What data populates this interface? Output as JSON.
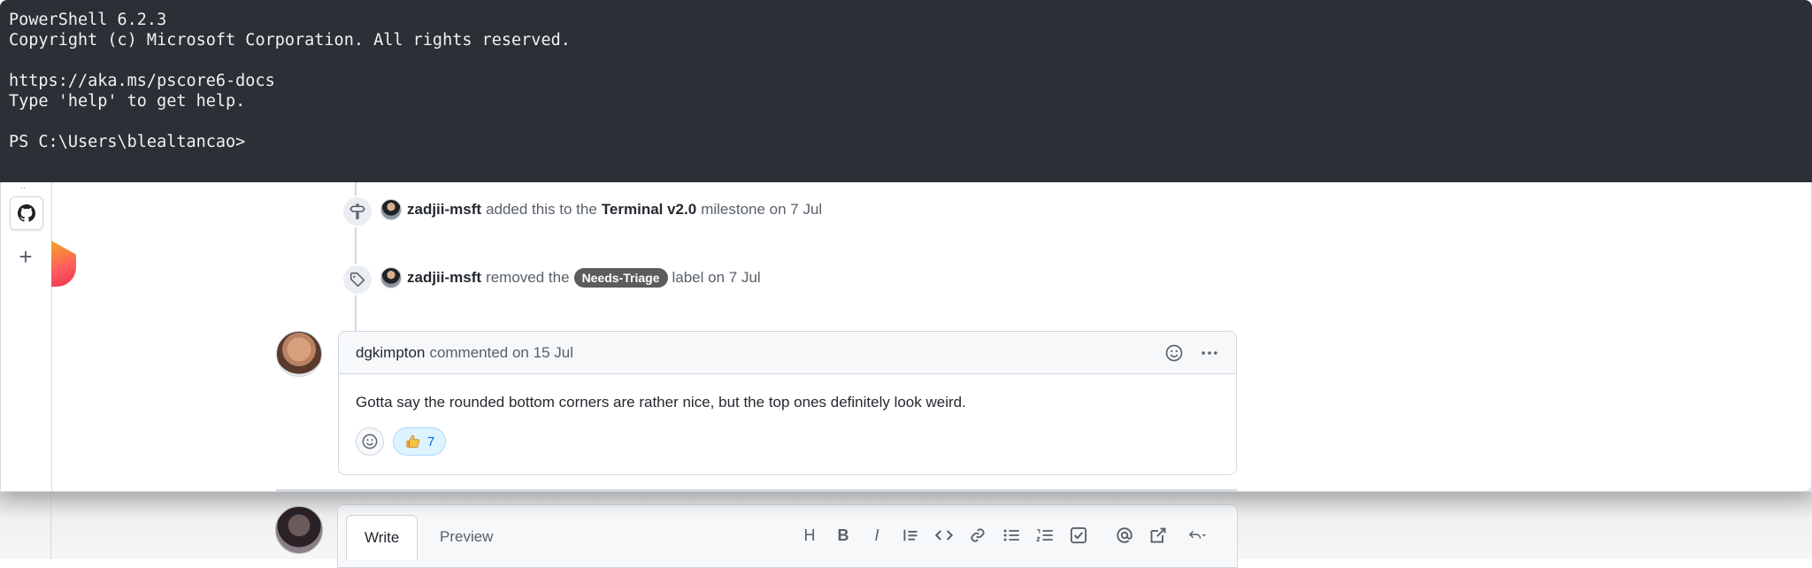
{
  "terminal": {
    "lines": [
      "PowerShell 6.2.3",
      "Copyright (c) Microsoft Corporation. All rights reserved.",
      "",
      "https://aka.ms/pscore6-docs",
      "Type 'help' to get help.",
      "",
      "PS C:\\Users\\blealtancao>"
    ],
    "background": "#2b2f36"
  },
  "sidebar": {
    "top_text": "..",
    "icons": [
      "github-icon",
      "plus-icon"
    ]
  },
  "timeline": {
    "events": [
      {
        "icon": "milestone-icon",
        "user": "zadjii-msft",
        "action": "added this to the",
        "target": "Terminal v2.0",
        "suffix": "milestone on 7 Jul"
      },
      {
        "icon": "tag-icon",
        "user": "zadjii-msft",
        "action": "removed the",
        "label": "Needs-Triage",
        "suffix": "label on 7 Jul"
      }
    ]
  },
  "comment": {
    "author": "dgkimpton",
    "meta": "commented on 15 Jul",
    "body": "Gotta say the rounded bottom corners are rather nice, but the top ones definitely look weird.",
    "reaction_thumbs_count": "7"
  },
  "editor": {
    "tabs": [
      "Write",
      "Preview"
    ],
    "toolbar": [
      "heading-icon",
      "bold-icon",
      "italic-icon",
      "quote-icon",
      "code-icon",
      "link-icon",
      "bulleted-list-icon",
      "numbered-list-icon",
      "task-list-icon",
      "mention-icon",
      "cross-reference-icon",
      "reply-icon"
    ],
    "toolbar_glyphs": {
      "heading": "H",
      "bold": "B",
      "italic": "I"
    }
  },
  "colors": {
    "label_bg": "#5c5c5c",
    "reaction_bg": "#ddf4ff",
    "link_blue": "#0969da"
  }
}
